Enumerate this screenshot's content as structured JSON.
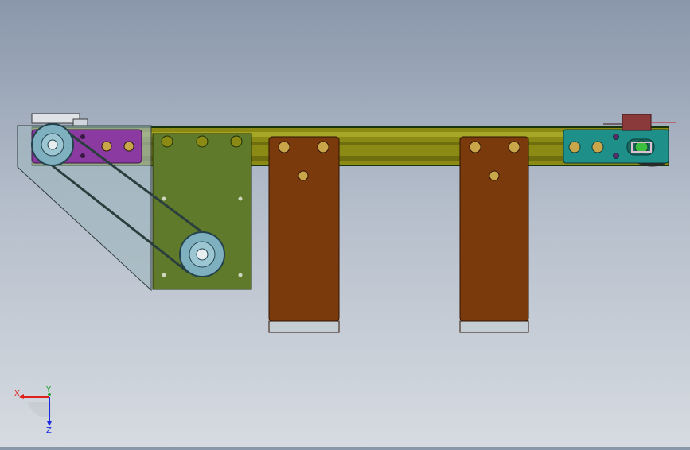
{
  "view": {
    "background_top": "#8a97ab",
    "background_bottom": "#d6dbe1"
  },
  "triad": {
    "x_label": "X",
    "y_label": "Y",
    "z_label": "Z",
    "x_color": "#e0201a",
    "y_color": "#1aa02a",
    "z_color": "#1a2ae0"
  },
  "parts": {
    "rail_color": "#8a8a14",
    "guard_color": "#9fb7bf",
    "motor_plate_color": "#5f7a2a",
    "purple_block_color": "#8a3aa0",
    "bracket_color": "#7a3a0c",
    "cyan_block_color": "#1f8f8a",
    "pulley_color": "#7fb0c0"
  }
}
